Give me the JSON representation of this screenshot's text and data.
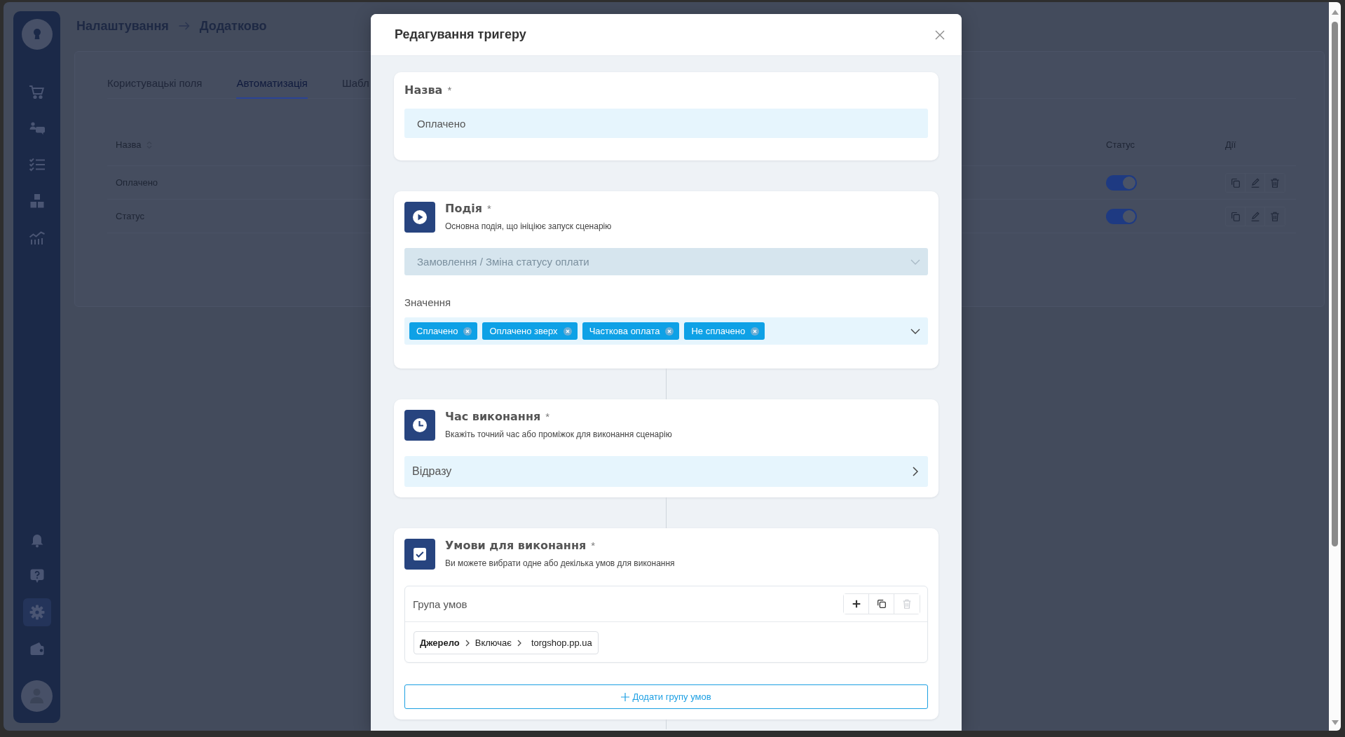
{
  "sidebar": {
    "items": [
      {
        "selected": false
      },
      {
        "selected": false
      },
      {
        "selected": false
      },
      {
        "selected": false
      },
      {
        "selected": false
      }
    ],
    "bottom_items": [
      {
        "selected": false
      },
      {
        "selected": false
      },
      {
        "selected": true
      },
      {
        "selected": false
      }
    ]
  },
  "breadcrumb": [
    "Налаштування",
    "Додатково"
  ],
  "tabs": [
    {
      "label": "Користувацькі поля",
      "selected": false
    },
    {
      "label": "Автоматизація",
      "selected": true
    },
    {
      "label": "Шабл",
      "selected": false
    }
  ],
  "table": {
    "columns": [
      {
        "label": "Назва",
        "sortable": true
      },
      {
        "label": "Статус",
        "sortable": false
      },
      {
        "label": "Дії",
        "sortable": false
      }
    ],
    "rows": [
      {
        "name": "Оплачено",
        "enabled": true
      },
      {
        "name": "Статус",
        "enabled": true
      }
    ]
  },
  "modal": {
    "title": "Редагування тригеру",
    "name_section": {
      "label": "Назва",
      "required_mark": "*",
      "value": "Оплачено"
    },
    "event_section": {
      "title": "Подія",
      "required_mark": "*",
      "description": "Основна подія, що ініціює запуск сценарію",
      "event": {
        "value": "Замовлення / Зміна статусу оплати",
        "disabled": true
      },
      "values_label": "Значення",
      "values": [
        "Сплачено",
        "Оплачено зверх",
        "Часткова оплата",
        "Не сплачено"
      ]
    },
    "timing_section": {
      "title": "Час виконання",
      "required_mark": "*",
      "description": "Вкажіть точний час або проміжок для виконання сценарію",
      "value": "Відразу"
    },
    "conditions_section": {
      "title": "Умови для виконання",
      "required_mark": "*",
      "description": "Ви можете вибрати одне або декілька умов для виконання",
      "groups": [
        {
          "title": "Група умов",
          "actions": [
            {
              "kind": "add",
              "disabled": false
            },
            {
              "kind": "copy",
              "disabled": false
            },
            {
              "kind": "delete",
              "disabled": true
            }
          ],
          "conditions": [
            {
              "field": "Джерело",
              "operator": "Включає",
              "value": "torgshop.pp.ua"
            }
          ]
        }
      ],
      "add_group_label": "Додати групу умов"
    }
  }
}
